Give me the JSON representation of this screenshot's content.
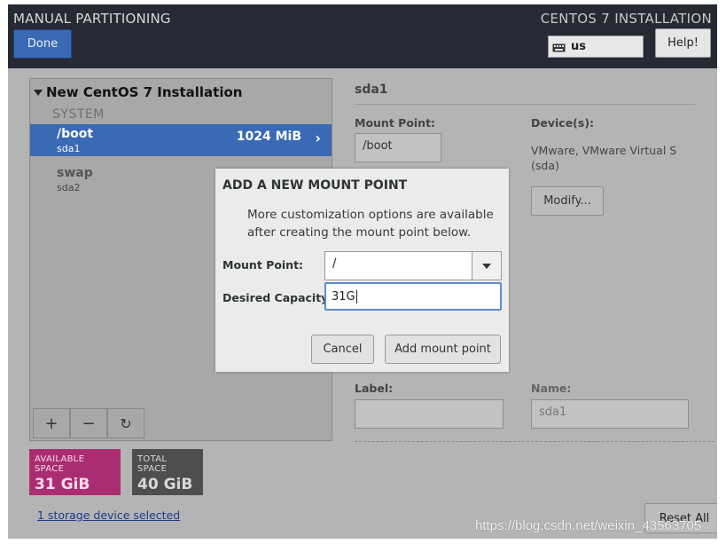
{
  "header": {
    "title": "MANUAL PARTITIONING",
    "done_label": "Done",
    "installer_title": "CENTOS 7 INSTALLATION",
    "keyboard_layout": "us",
    "help_label": "Help!"
  },
  "left_pane": {
    "installation_title": "New CentOS 7 Installation",
    "system_label": "SYSTEM",
    "mount_points": [
      {
        "name": "/boot",
        "device": "sda1",
        "size": "1024 MiB",
        "selected": true
      },
      {
        "name": "swap",
        "device": "sda2",
        "size": "",
        "selected": false
      }
    ],
    "toolbar": {
      "add": "+",
      "remove": "−",
      "refresh": "↻"
    }
  },
  "space": {
    "available_label": "AVAILABLE SPACE",
    "available_value": "31 GiB",
    "total_label": "TOTAL SPACE",
    "total_value": "40 GiB"
  },
  "storage_link": "1 storage device selected",
  "right_pane": {
    "title": "sda1",
    "mount_point_label": "Mount Point:",
    "mount_point_value": "/boot",
    "devices_label": "Device(s):",
    "devices_value_line1": "VMware, VMware Virtual S",
    "devices_value_line2": "(sda)",
    "modify_label": "Modify...",
    "label_label": "Label:",
    "label_value": "",
    "name_label": "Name:",
    "name_value": "sda1",
    "reset_label": "Reset All"
  },
  "dialog": {
    "title": "ADD A NEW MOUNT POINT",
    "description": "More customization options are available after creating the mount point below.",
    "mount_point_label": "Mount Point:",
    "mount_point_value": "/",
    "capacity_label": "Desired Capacity:",
    "capacity_value": "31G",
    "cancel_label": "Cancel",
    "add_label": "Add mount point"
  },
  "watermark": "https://blog.csdn.net/weixin_43563705",
  "colors": {
    "header_bg": "#262a35",
    "accent_blue": "#3a6ab4",
    "available_space": "#aa2d72",
    "total_space": "#4e4e4e"
  }
}
